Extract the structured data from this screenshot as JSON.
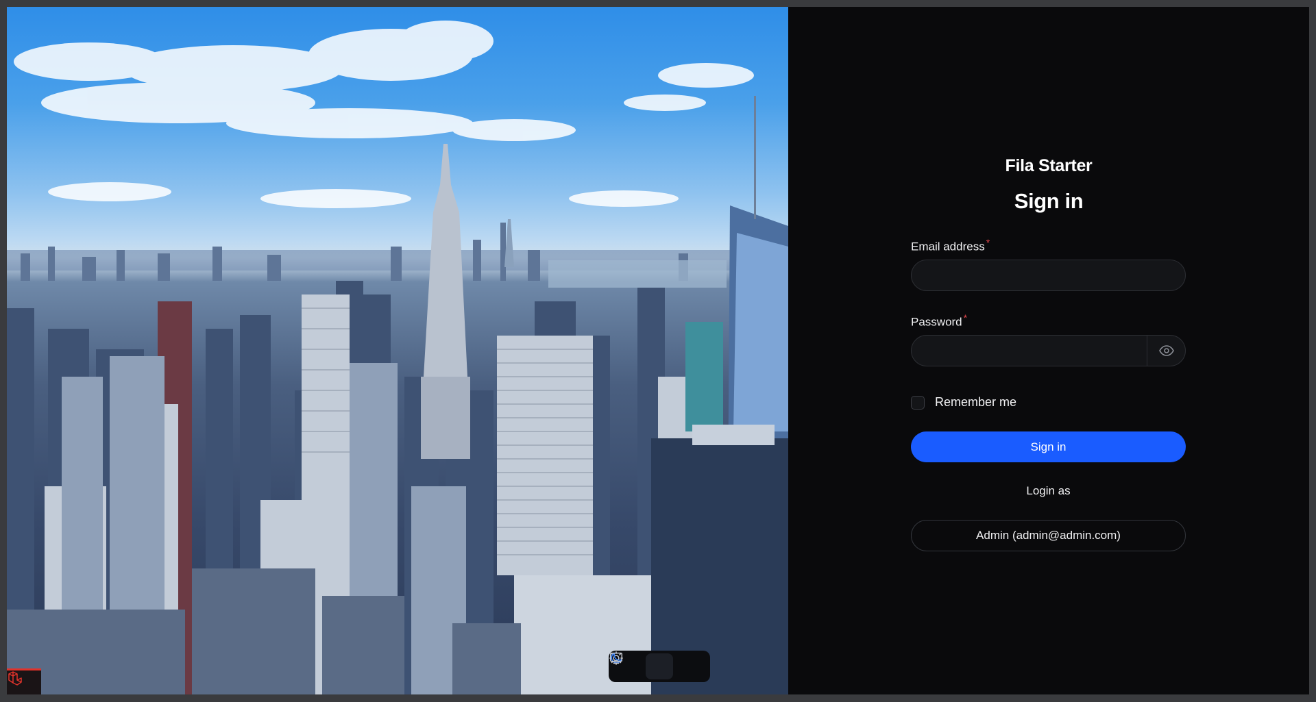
{
  "app": {
    "brand": "Fila Starter",
    "heading": "Sign in"
  },
  "form": {
    "email_label": "Email address",
    "email_value": "",
    "password_label": "Password",
    "password_value": "",
    "required_marker": "*",
    "remember_label": "Remember me",
    "remember_checked": false,
    "submit_label": "Sign in",
    "login_as_label": "Login as",
    "quick_login_label": "Admin (admin@admin.com)"
  },
  "theme_switcher": {
    "options": [
      "light",
      "dark",
      "system"
    ],
    "selected": "dark"
  },
  "icons": {
    "password_toggle": "eye-icon",
    "light": "sun-icon",
    "dark": "moon-icon",
    "system": "monitor-icon",
    "badge": "laravel-logo-icon"
  },
  "colors": {
    "background": "#0a0a0c",
    "primary": "#1a5cff",
    "required": "#e5484d",
    "text": "#f1f1f3",
    "moon_active": "#3b82f6"
  }
}
